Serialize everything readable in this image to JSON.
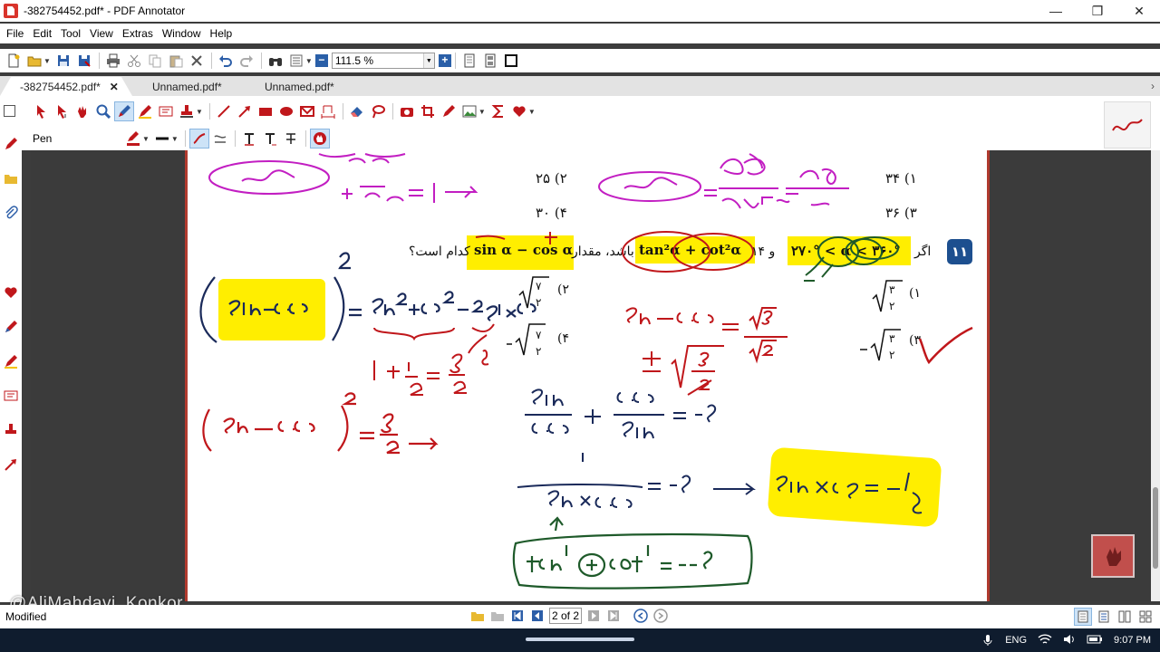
{
  "window": {
    "title": "-382754452.pdf* - PDF Annotator",
    "minimize": "—",
    "maximize": "❐",
    "close": "✕"
  },
  "menu": [
    "File",
    "Edit",
    "Tool",
    "View",
    "Extras",
    "Window",
    "Help"
  ],
  "toolbar": {
    "zoom_value": "111.5 %",
    "zoom_minus": "−",
    "zoom_plus": "+"
  },
  "tabs": [
    {
      "label": "-382754452.pdf*",
      "active": true,
      "close": "✕"
    },
    {
      "label": "Unnamed.pdf*",
      "active": false
    },
    {
      "label": "Unnamed.pdf*",
      "active": false
    }
  ],
  "tab_scroll": "›",
  "annotation_toolbar": {
    "tool_name": "Pen"
  },
  "document": {
    "question_number": "۱۱",
    "question_text_if": "اگر",
    "question_condition": "و ۱۴",
    "question_middle": "باشد، مقدار",
    "question_end": "کدام است؟",
    "option_labels": [
      "(۱",
      "(۲",
      "(۳",
      "(۴"
    ],
    "top_options": [
      {
        "label": "(۱",
        "value": "۳۴"
      },
      {
        "label": "(۲",
        "value": "۲۵"
      },
      {
        "label": "(۳",
        "value": "۳۶"
      },
      {
        "label": "(۴",
        "value": "۳۰"
      }
    ],
    "expr_sin_cos": "sin α − cos α",
    "expr_tan_cot": "tan²α + cot²α",
    "expr_angle": "۲۷۰° < α < ۳۶۰°",
    "handwriting": {
      "sual_left": "سوال",
      "sual_right": "سوال",
      "frac_left": "+ ۸/۲۵ = ۱ ⟶",
      "frac_right": "۱۷×۲ / ۲۸×۶ = ۶۸",
      "sin_minus_cos": "Sin − C·S",
      "expand": "= Sin² + C·S² − ۲ Sin×C·S",
      "sin_cos_eq": "Sin − C·S = √۳ / √۲",
      "sum_frac": "۱ + ۱/۲ = ۳/۲",
      "square_eq": "(Sin − C·S)² = ۳/۲ ⟶",
      "sin_over_cos": "Sin/C·S + C·S/Sin = −۴",
      "plus_root": "± √(۳/۲)",
      "reciprocal": "۱ / Sin × C·S = −۴ ⟶",
      "result": "Sin × C·S = −½",
      "tan_cot": "tan + cot = −۴"
    }
  },
  "floating_button_icon": "hand-icon",
  "watermark": "@AliMahdavi_Konkor",
  "status": {
    "text": "Modified",
    "page_indicator": "2 of 2"
  },
  "taskbar": {
    "language": "ENG",
    "time": "9:07 PM"
  },
  "colors": {
    "accent_blue": "#1d4f8f",
    "highlight_yellow": "#ffee00",
    "pen_red": "#c0171b",
    "pen_magenta": "#c21ec2",
    "pen_green": "#1e5a2a",
    "pen_navy": "#1a2a5a"
  }
}
